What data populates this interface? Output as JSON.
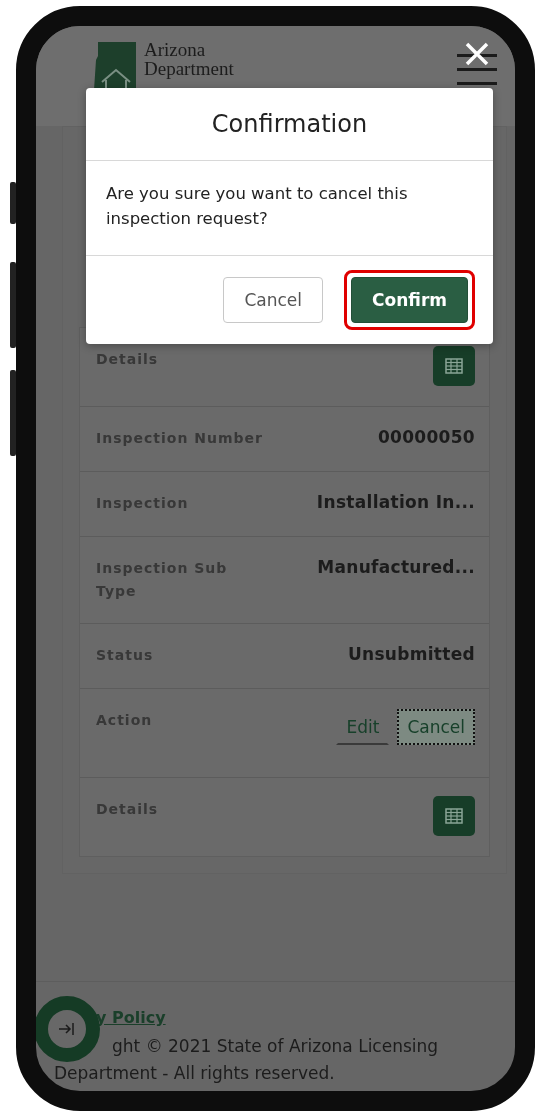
{
  "header": {
    "logo_lines": [
      "Arizona",
      "Department"
    ]
  },
  "modal": {
    "title": "Confirmation",
    "message": "Are you sure you want to cancel this inspection request?",
    "buttons": [
      {
        "label": "Cancel",
        "kind": "secondary",
        "highlighted": false
      },
      {
        "label": "Confirm",
        "kind": "primary",
        "highlighted": true
      }
    ]
  },
  "rows": [
    {
      "kind": "icon",
      "label": "Details"
    },
    {
      "kind": "text",
      "label": "Inspection Number",
      "value": "00000050"
    },
    {
      "kind": "text",
      "label": "Inspection",
      "value": "Installation In..."
    },
    {
      "kind": "text",
      "label": "Inspection Sub Type",
      "value": "Manufactured..."
    },
    {
      "kind": "text",
      "label": "Status",
      "value": "Unsubmitted"
    },
    {
      "kind": "actions",
      "label": "Action",
      "actions": [
        {
          "label": "Edit",
          "focused": false
        },
        {
          "label": "Cancel",
          "focused": true
        }
      ]
    },
    {
      "kind": "icon",
      "label": "Details"
    }
  ],
  "footer": {
    "link": "y Policy",
    "copyright_lines": [
      "ght © 2021 State of Arizona Licensing",
      "Department - All rights reserved."
    ]
  }
}
